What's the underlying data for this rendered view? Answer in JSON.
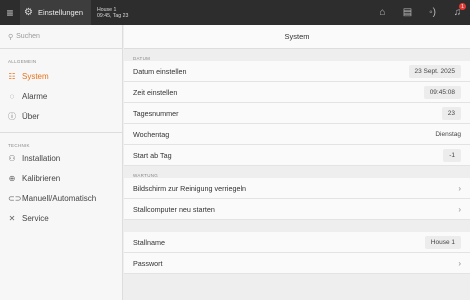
{
  "topbar": {
    "title": "Einstellungen",
    "device_name": "House 1",
    "device_info": "09:45, Tag 23",
    "icons": [
      "home-icon",
      "document-icon",
      "wifi-icon",
      "bell-icon"
    ],
    "badge": "1"
  },
  "sidebar": {
    "search_placeholder": "Suchen",
    "section_general": "ALLGEMEIN",
    "section_technik": "TECHNIK",
    "general_items": [
      {
        "label": "System",
        "icon": "system-icon",
        "active": true
      },
      {
        "label": "Alarme",
        "icon": "alarm-icon",
        "active": false
      },
      {
        "label": "Über",
        "icon": "info-icon",
        "active": false
      }
    ],
    "technik_items": [
      {
        "label": "Installation",
        "icon": "installation-icon"
      },
      {
        "label": "Kalibrieren",
        "icon": "calibrate-icon"
      },
      {
        "label": "Manuell/Automatisch",
        "icon": "toggle-icon"
      },
      {
        "label": "Service",
        "icon": "wrench-icon"
      }
    ]
  },
  "main": {
    "title": "System",
    "group_datum": "DATUM",
    "group_wartung": "WARTUNG",
    "datum_rows": [
      {
        "label": "Datum einstellen",
        "value": "23 Sept. 2025"
      },
      {
        "label": "Zeit einstellen",
        "value": "09:45:08"
      },
      {
        "label": "Tagesnummer",
        "value": "23"
      },
      {
        "label": "Wochentag",
        "value": "Dienstag"
      },
      {
        "label": "Start ab Tag",
        "value": "-1"
      }
    ],
    "wartung_rows": [
      {
        "label": "Bildschirm zur Reinigung verriegeln"
      },
      {
        "label": "Stallcomputer neu starten"
      }
    ],
    "stall_rows": [
      {
        "label": "Stallname",
        "value": "House 1"
      },
      {
        "label": "Passwort"
      }
    ]
  },
  "colors": {
    "accent": "#e8711a",
    "topbar": "#2d2d2d",
    "badge": "#e53935"
  }
}
